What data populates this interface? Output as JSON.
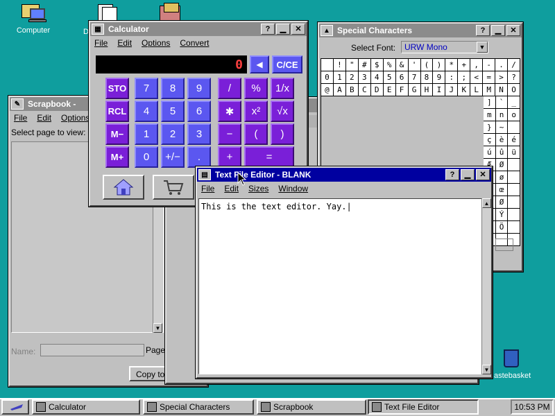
{
  "desktop": {
    "icons": [
      {
        "label": "Computer"
      },
      {
        "label": "D"
      },
      {
        "label": ""
      }
    ],
    "wastebasket_label": "astebasket"
  },
  "calculator": {
    "title": "Calculator",
    "menu": [
      "File",
      "Edit",
      "Options",
      "Convert"
    ],
    "display": "0",
    "back_key": "◀",
    "clear_key": "C/CE",
    "memory_keys": [
      "STO",
      "RCL",
      "M−",
      "M+"
    ],
    "digit_keys": [
      "7",
      "8",
      "9",
      "4",
      "5",
      "6",
      "1",
      "2",
      "3",
      "0",
      "+/−",
      "."
    ],
    "op_keys": [
      "/",
      "%",
      "1/x",
      "✱",
      "x²",
      "√x",
      "−",
      "(",
      ")",
      "+",
      "="
    ]
  },
  "special_chars": {
    "title": "Special Characters",
    "font_label": "Select Font:",
    "font_value": "URW Mono",
    "rows": [
      [
        "",
        "!",
        "\"",
        "#",
        "$",
        "%",
        "&",
        "'",
        "(",
        ")",
        "*",
        "+",
        ",",
        "-",
        ".",
        "/"
      ],
      [
        "0",
        "1",
        "2",
        "3",
        "4",
        "5",
        "6",
        "7",
        "8",
        "9",
        ":",
        ";",
        "<",
        "=",
        ">",
        "?"
      ],
      [
        "@",
        "A",
        "B",
        "C",
        "D",
        "E",
        "F",
        "G",
        "H",
        "I",
        "J",
        "K",
        "L",
        "M",
        "N",
        "O"
      ]
    ],
    "right_cols": [
      [
        "]",
        "`",
        "_"
      ],
      [
        "m",
        "n",
        "o"
      ],
      [
        "}",
        "~",
        ""
      ],
      [
        "ç",
        "è",
        "é"
      ],
      [
        "ú",
        "û",
        "ü"
      ],
      [
        "Æ",
        "Ø",
        ""
      ],
      [
        "æ",
        "ø",
        ""
      ],
      [
        "Œ",
        "œ",
        ""
      ],
      [
        "R",
        "Ø",
        ""
      ],
      [
        "Ü",
        "Ý",
        ""
      ],
      [
        "Õ",
        "Ö",
        ""
      ],
      [
        ".",
        "",
        ""
      ]
    ]
  },
  "scrapbook": {
    "title": "Scrapbook -",
    "menu": [
      "File",
      "Edit",
      "Options"
    ],
    "select_label": "Select page to view:",
    "name_label": "Name:",
    "page_label": "Page 1 of 1 (",
    "copy_button": "Copy to Clipboar"
  },
  "editor": {
    "title": "Text File Editor - BLANK",
    "menu": [
      "File",
      "Edit",
      "Sizes",
      "Window"
    ],
    "content": "This is the text editor. Yay."
  },
  "taskbar": {
    "items": [
      "Calculator",
      "Special Characters",
      "Scrapbook",
      "Text File Editor"
    ],
    "clock": "10:53 PM"
  }
}
